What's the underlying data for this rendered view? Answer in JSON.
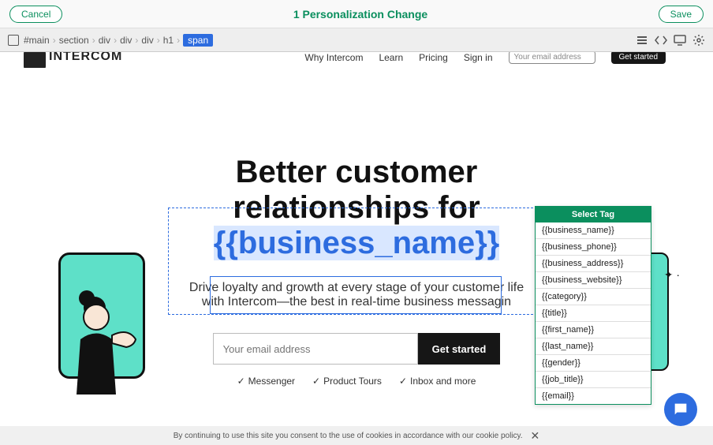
{
  "toolbar": {
    "cancel": "Cancel",
    "save": "Save",
    "title": "1 Personalization Change"
  },
  "breadcrumb": {
    "items": [
      "#main",
      "section",
      "div",
      "div",
      "div",
      "h1",
      "span"
    ]
  },
  "nav": {
    "logo_text": "INTERCOM",
    "items": [
      "Why Intercom",
      "Learn",
      "Pricing",
      "Sign in"
    ],
    "email_placeholder": "Your email address",
    "cta": "Get started"
  },
  "hero": {
    "line1": "Better customer",
    "line2": "relationships for",
    "tag": "{{business_name}}",
    "sub1": "Drive loyalty and growth at every stage of your customer life",
    "sub2": "with Intercom—the best in real-time business messagin",
    "email_placeholder": "Your email address",
    "cta": "Get started",
    "features": [
      "Messenger",
      "Product Tours",
      "Inbox and more"
    ]
  },
  "tag_menu": {
    "header": "Select Tag",
    "items": [
      "{{business_name}}",
      "{{business_phone}}",
      "{{business_address}}",
      "{{business_website}}",
      "{{category}}",
      "{{title}}",
      "{{first_name}}",
      "{{last_name}}",
      "{{gender}}",
      "{{job_title}}",
      "{{email}}"
    ]
  },
  "cookie": {
    "text": "By continuing to use this site you consent to the use of cookies in accordance with our cookie policy."
  }
}
